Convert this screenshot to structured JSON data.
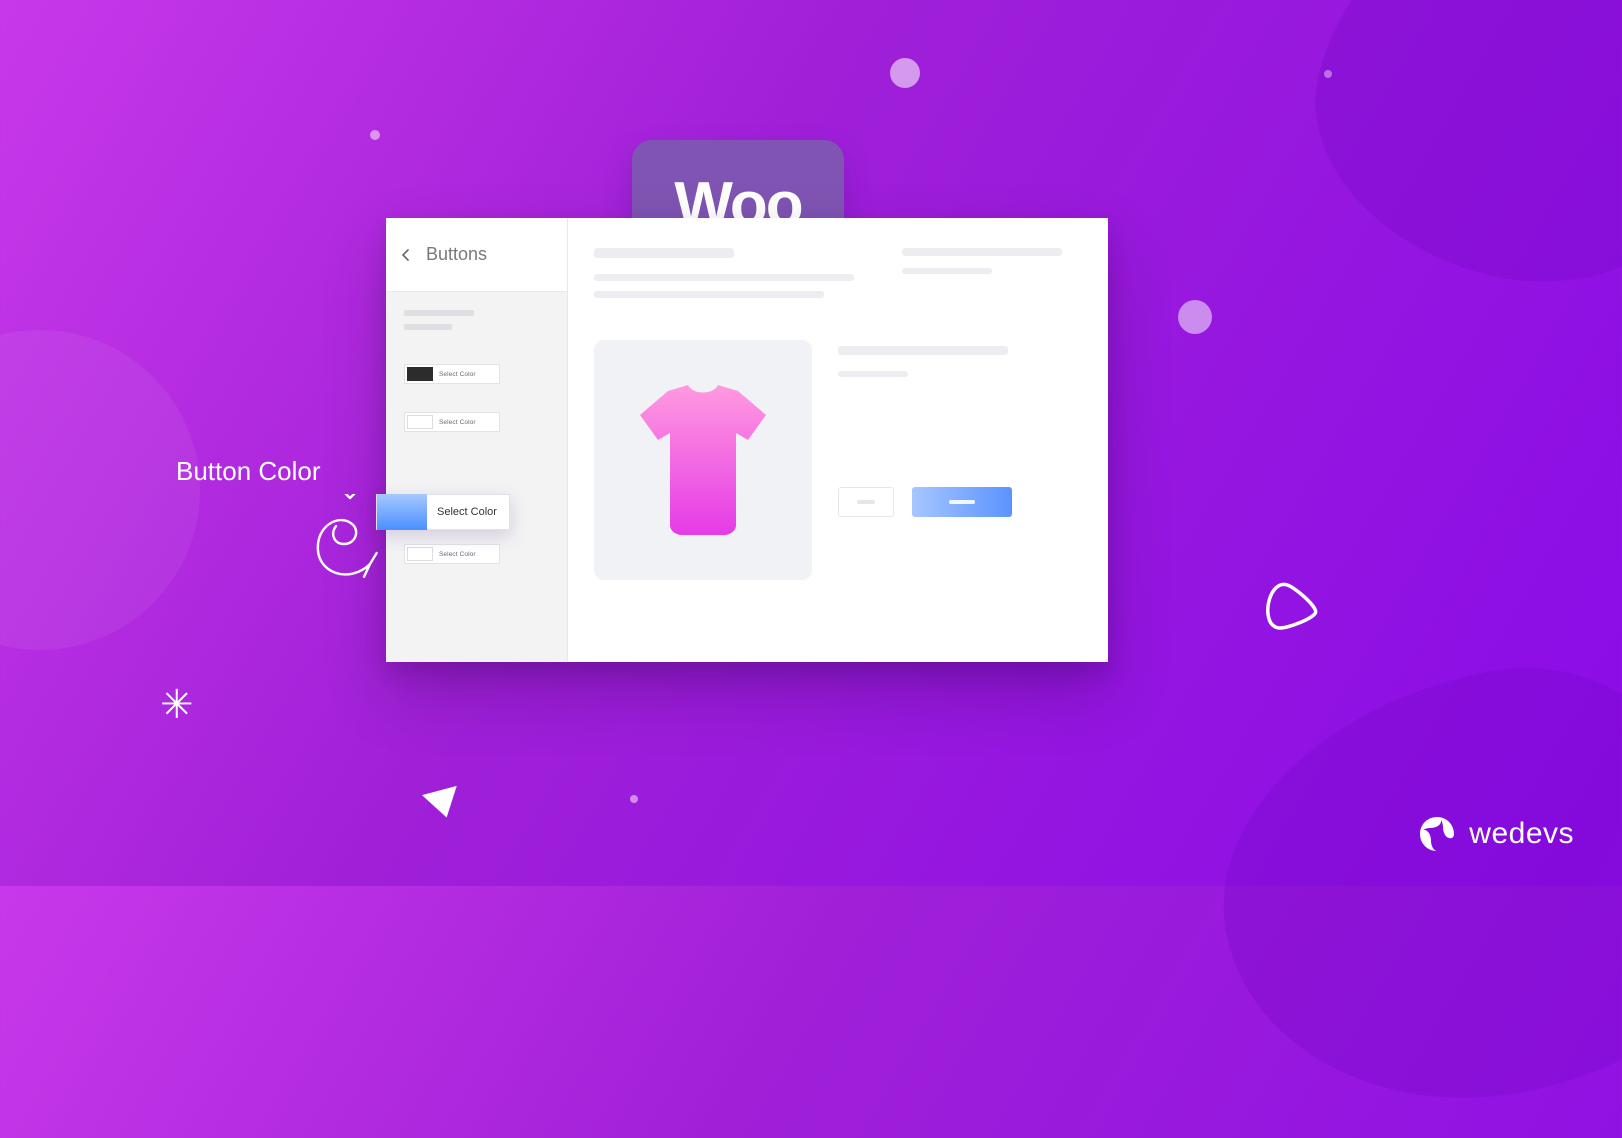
{
  "woo_logo_text": "Woo",
  "callout_label": "Button Color",
  "sidebar": {
    "title": "Buttons"
  },
  "color_rows": {
    "tiny_select_label": "Select Color",
    "big_select_label": "Select Color"
  },
  "brand": {
    "name": "wedevs"
  }
}
